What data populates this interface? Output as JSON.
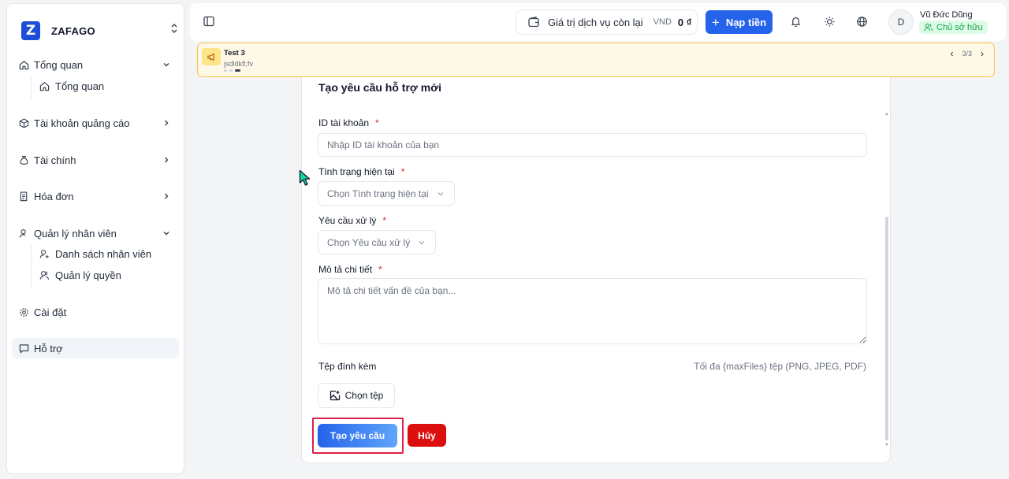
{
  "brand": {
    "name": "ZAFAGO",
    "logo_letter": "Z"
  },
  "sidebar": {
    "items": [
      {
        "label": "Tổng quan",
        "icon": "home-icon",
        "expanded": true,
        "children": [
          {
            "label": "Tổng quan",
            "icon": "home-icon"
          }
        ]
      },
      {
        "label": "Tài khoản quảng cáo",
        "icon": "box-icon"
      },
      {
        "label": "Tài chính",
        "icon": "money-bag-icon"
      },
      {
        "label": "Hóa đơn",
        "icon": "receipt-icon"
      },
      {
        "label": "Quản lý nhân viên",
        "icon": "user-icon",
        "expanded": true,
        "children": [
          {
            "label": "Danh sách nhân viên",
            "icon": "user-plus-icon"
          },
          {
            "label": "Quản lý quyền",
            "icon": "users-icon"
          }
        ]
      },
      {
        "label": "Cài đặt",
        "icon": "gear-icon"
      },
      {
        "label": "Hỗ trợ",
        "icon": "message-icon",
        "active": true
      }
    ]
  },
  "header": {
    "balance_label": "Giá trị dịch vụ còn lại",
    "currency": "VND",
    "balance_amount": "0 ₫",
    "topup_label": "Nạp tiền",
    "user": {
      "initial": "D",
      "name": "Vũ Đức Dũng",
      "role": "Chủ sở hữu"
    }
  },
  "announcement": {
    "title": "Test 3",
    "body": "jsdldkfl;fv",
    "counter": "3/3",
    "dots": 3,
    "active_dot": 3
  },
  "form": {
    "title": "Tạo yêu cầu hỗ trợ mới",
    "required_mark": "*",
    "account_id": {
      "label": "ID tài khoản",
      "placeholder": "Nhập ID tài khoản của bạn",
      "value": ""
    },
    "status": {
      "label": "Tình trạng hiện tại",
      "placeholder": "Chọn Tình trạng hiện tại"
    },
    "request": {
      "label": "Yêu cầu xử lý",
      "placeholder": "Chọn Yêu cầu xử lý"
    },
    "description": {
      "label": "Mô tả chi tiết",
      "placeholder": "Mô tả chi tiết vấn đề của bạn..."
    },
    "attachments": {
      "label": "Tệp đính kèm",
      "hint": "Tối đa {maxFiles} tệp (PNG, JPEG, PDF)",
      "button_label": "Chọn tệp"
    },
    "submit_label": "Tạo yêu cầu",
    "cancel_label": "Hủy"
  },
  "colors": {
    "primary": "#2563eb",
    "danger": "#dc0f0f",
    "highlight": "#e11d48",
    "banner_border": "#f5c542"
  }
}
